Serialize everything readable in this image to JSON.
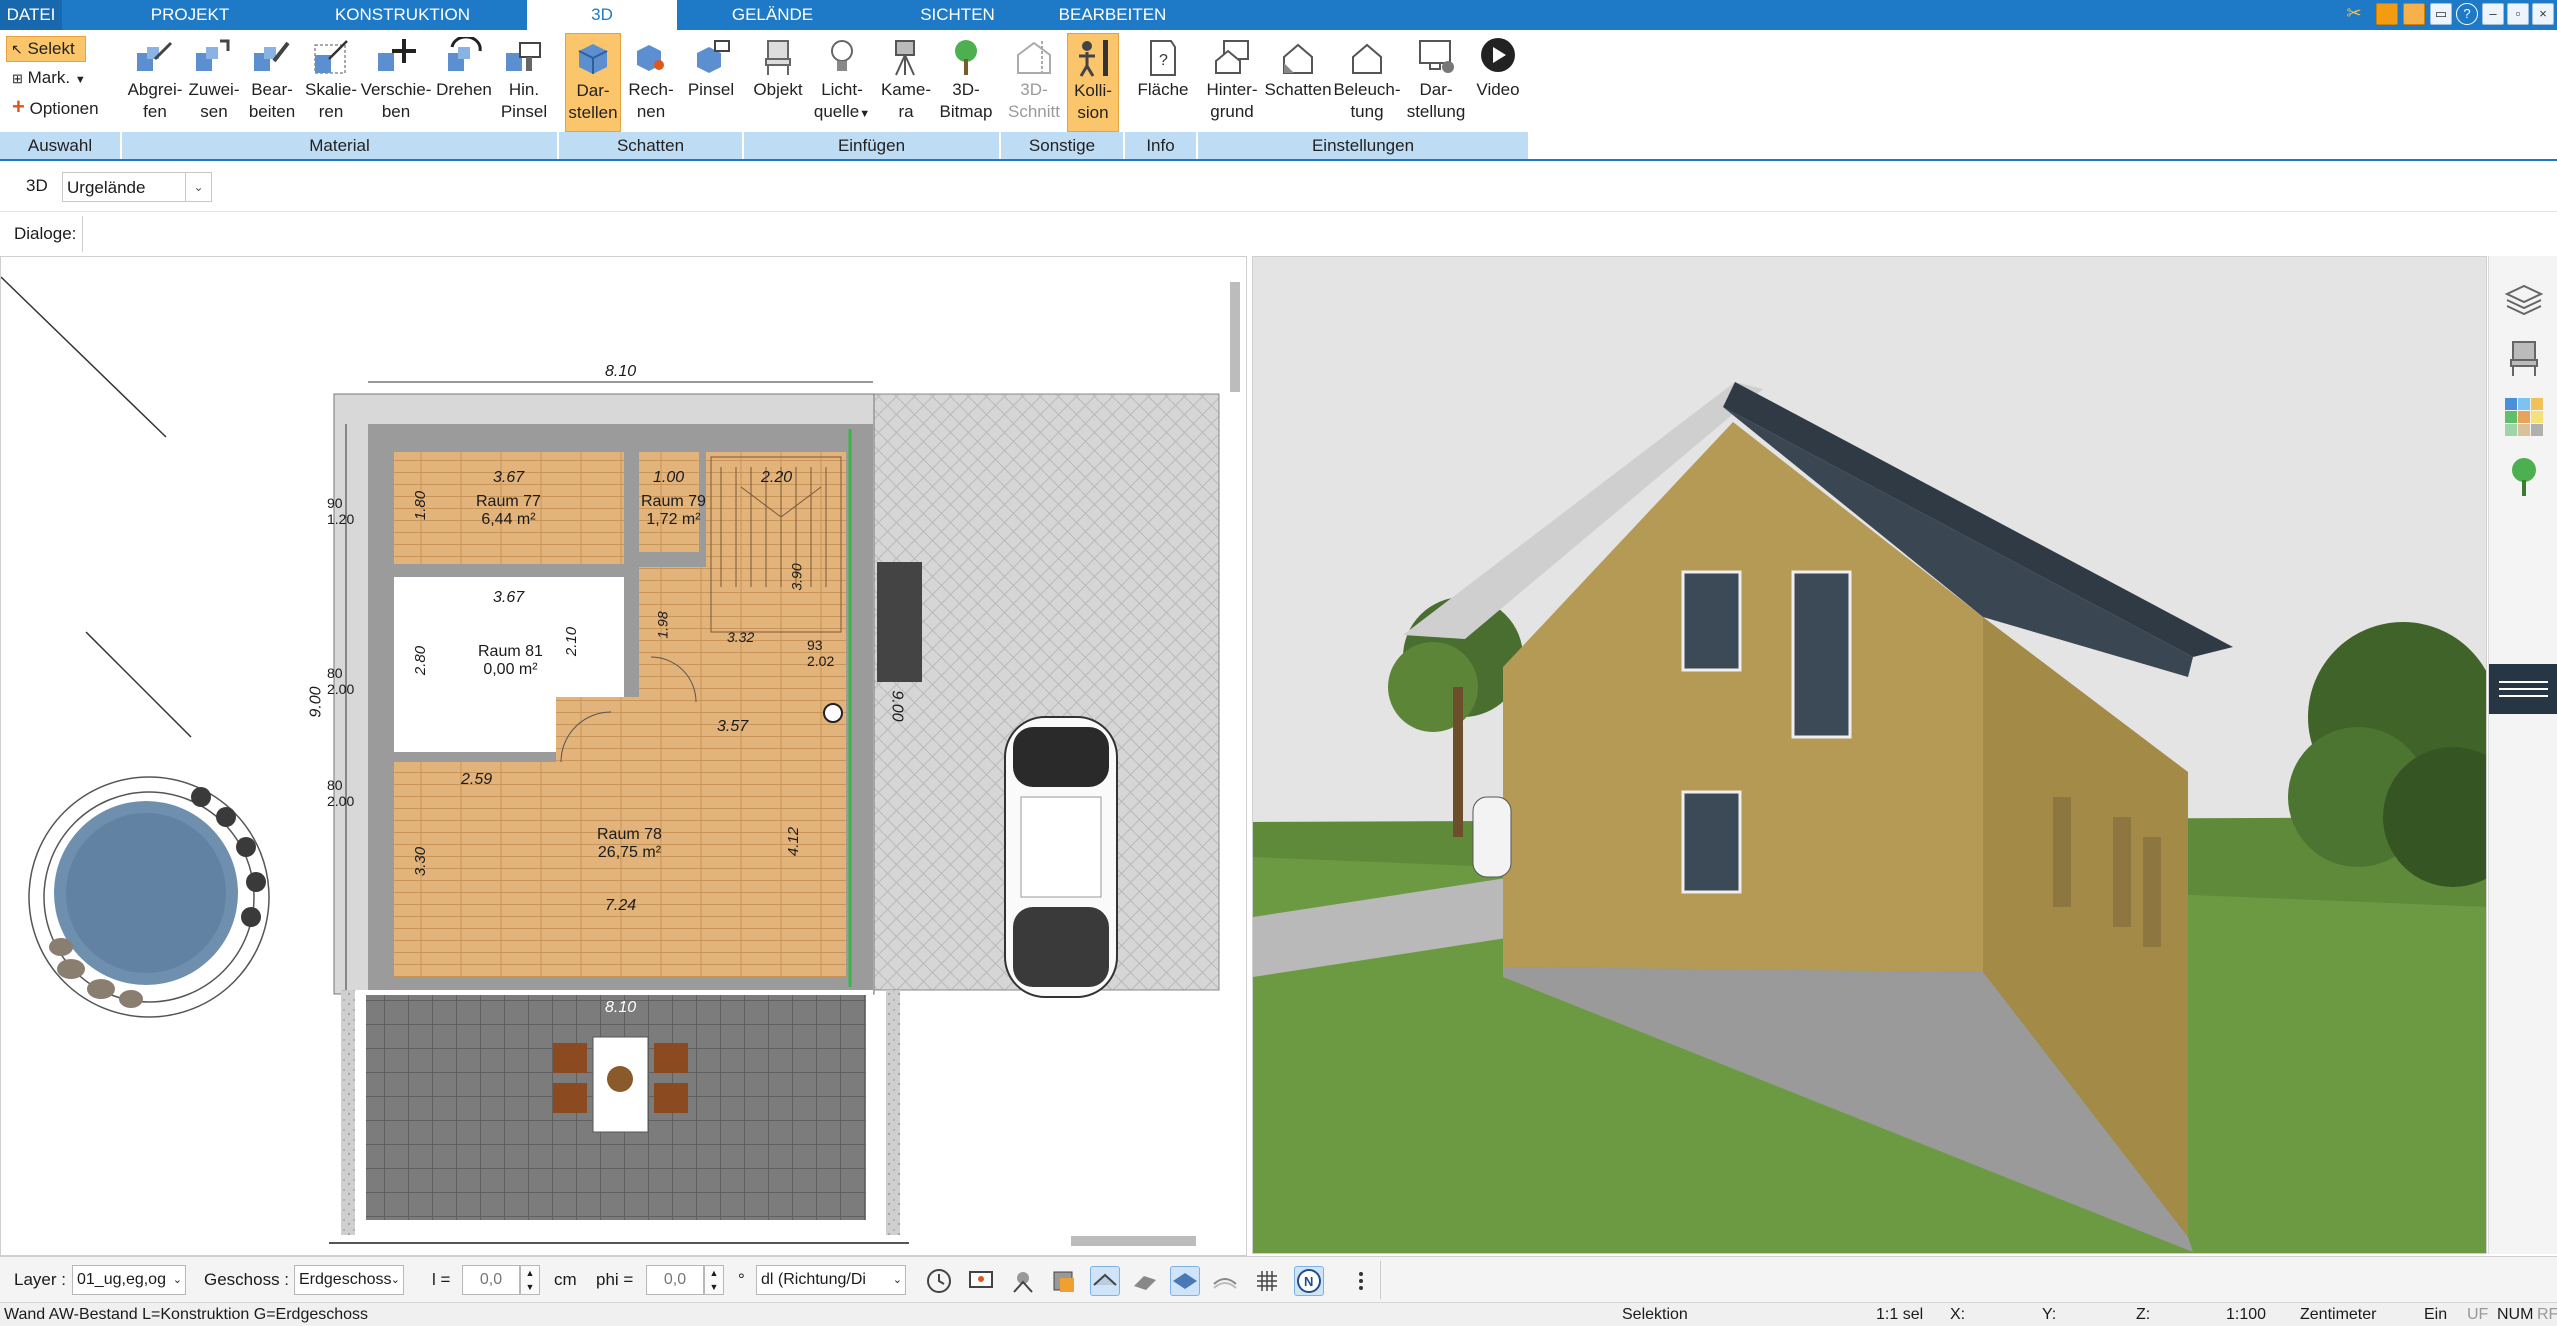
{
  "tabs": [
    "DATEI",
    "PROJEKT",
    "KONSTRUKTION",
    "3D",
    "GELÄNDE",
    "SICHTEN",
    "BEARBEITEN"
  ],
  "selection": {
    "selekt": "Selekt",
    "mark": "Mark.",
    "optionen": "Optionen"
  },
  "ribbon": {
    "material": [
      {
        "l1": "Abgrei-",
        "l2": "fen",
        "icon": "eyedropper-icon"
      },
      {
        "l1": "Zuwei-",
        "l2": "sen",
        "icon": "assign-icon"
      },
      {
        "l1": "Bear-",
        "l2": "beiten",
        "icon": "edit-material-icon"
      },
      {
        "l1": "Skalie-",
        "l2": "ren",
        "icon": "scale-icon"
      },
      {
        "l1": "Verschie-",
        "l2": "ben",
        "icon": "move-icon"
      },
      {
        "l1": "Drehen",
        "l2": "",
        "icon": "rotate-icon"
      },
      {
        "l1": "Hin.",
        "l2": "Pinsel",
        "icon": "brush-icon"
      }
    ],
    "schatten": [
      {
        "l1": "Dar-",
        "l2": "stellen",
        "icon": "cube-render-icon"
      },
      {
        "l1": "Rech-",
        "l2": "nen",
        "icon": "cube-calc-icon"
      },
      {
        "l1": "Pinsel",
        "l2": "",
        "icon": "cube-brush-icon"
      }
    ],
    "einfuegen": [
      {
        "l1": "Objekt",
        "l2": "",
        "icon": "chair-icon"
      },
      {
        "l1": "Licht-",
        "l2": "quelle",
        "icon": "lightbulb-icon"
      },
      {
        "l1": "Kame-",
        "l2": "ra",
        "icon": "camera-icon"
      },
      {
        "l1": "3D-",
        "l2": "Bitmap",
        "icon": "tree-icon"
      }
    ],
    "sonstige": [
      {
        "l1": "3D-",
        "l2": "Schnitt",
        "icon": "section-icon"
      },
      {
        "l1": "Kolli-",
        "l2": "sion",
        "icon": "collision-icon"
      }
    ],
    "info": [
      {
        "l1": "Fläche",
        "l2": "",
        "icon": "area-icon"
      }
    ],
    "einstellungen": [
      {
        "l1": "Hinter-",
        "l2": "grund",
        "icon": "background-icon"
      },
      {
        "l1": "Schatten",
        "l2": "",
        "icon": "house-shadow-icon"
      },
      {
        "l1": "Beleuch-",
        "l2": "tung",
        "icon": "house-light-icon"
      },
      {
        "l1": "Dar-",
        "l2": "stellung",
        "icon": "monitor-icon"
      },
      {
        "l1": "Video",
        "l2": "",
        "icon": "play-icon"
      }
    ],
    "groups": [
      "Auswahl",
      "Material",
      "Schatten",
      "Einfügen",
      "Sonstige",
      "Info",
      "Einstellungen"
    ]
  },
  "row3d": {
    "label": "3D",
    "dropdown": "Urgelände"
  },
  "dialoge": "Dialoge:",
  "plan": {
    "dims": {
      "top": "8.10",
      "left": "9.00",
      "right": "9.00",
      "bottom": "8.10",
      "r77w": "3.67",
      "r77h": "1.80",
      "r81w": "3.67",
      "r81h": "2.80",
      "r81h2": "2.10",
      "r78w": "7.24",
      "r78h": "3.30",
      "r78h2": "4.12",
      "r78top": "3.57",
      "r78l": "2.59",
      "st1": "1.00",
      "st2": "2.20",
      "d1": "1.80",
      "d2": "2.00",
      "w1": "90",
      "w2": "1.20",
      "w3": "80",
      "w4": "2.00",
      "h1": "3.90",
      "h2": "2.02",
      "h3": "1.98",
      "h4": "3.32",
      "h5": "93",
      "b1": "90",
      "b2": "1.20",
      "b3": "80",
      "b4": "2.00"
    },
    "rooms": [
      {
        "name": "Raum 77",
        "area": "6,44 m²"
      },
      {
        "name": "Raum 79",
        "area": "1,72 m²"
      },
      {
        "name": "Raum 81",
        "area": "0,00 m²"
      },
      {
        "name": "Raum 78",
        "area": "26,75 m²"
      }
    ]
  },
  "bottom": {
    "layer_label": "Layer :",
    "layer_value": "01_ug,eg,og",
    "geschoss_label": "Geschoss :",
    "geschoss_value": "Erdgeschoss",
    "l_label": "l =",
    "l_value": "0,0",
    "cm": "cm",
    "phi_label": "phi =",
    "phi_value": "0,0",
    "deg": "°",
    "dl_value": "dl (Richtung/Di"
  },
  "status": {
    "left": "Wand AW-Bestand L=Konstruktion G=Erdgeschoss",
    "mode": "Selektion",
    "sel": "1:1 sel",
    "x": "X:",
    "y": "Y:",
    "z": "Z:",
    "scale": "1:100",
    "unit": "Zentimeter",
    "ein": "Ein",
    "uf": "UF",
    "num": "NUM",
    "rf": "RF"
  },
  "colors": {
    "accent": "#1e7ac6",
    "ribbon_group": "#bfdcf5",
    "highlight": "#fbc56c",
    "wall": "#9b9b9b",
    "floor": "#e2b37a",
    "grass": "#5f8a3a",
    "sky": "#e4e4e4",
    "facade": "#b49a55",
    "roof": "#2f3a45"
  }
}
